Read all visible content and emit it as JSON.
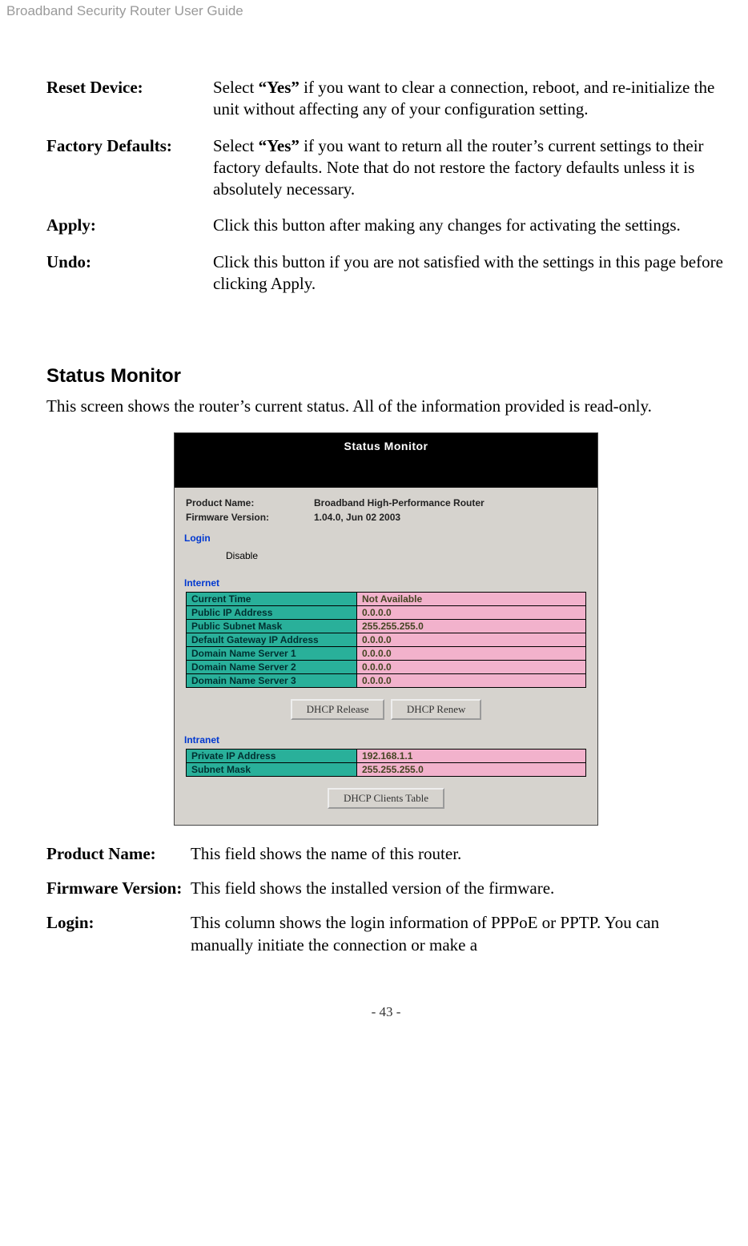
{
  "header": "Broadband Security Router User Guide",
  "defs1": [
    {
      "term": "Reset Device:",
      "pre": "Select ",
      "bold": "“Yes”",
      "post": " if you want to clear a connection, reboot, and re-initialize the unit without affecting any of your configuration setting."
    },
    {
      "term": "Factory Defaults:",
      "pre": "Select ",
      "bold": "“Yes”",
      "post": " if you want to return all the router’s current settings to their factory defaults. Note that do not restore the factory defaults unless it is absolutely necessary."
    },
    {
      "term": "Apply:",
      "pre": "Click this button after making any changes for activating the settings.",
      "bold": "",
      "post": ""
    },
    {
      "term": "Undo:",
      "pre": "Click this button if you are not satisfied with the settings in this page before clicking Apply.",
      "bold": "",
      "post": ""
    }
  ],
  "section": {
    "title": "Status Monitor",
    "intro": "This screen shows the router’s current status. All of the information provided is read-only."
  },
  "screenshot": {
    "title": "Status Monitor",
    "info": {
      "productNameLabel": "Product Name:",
      "productNameValue": "Broadband High-Performance Router",
      "firmwareLabel": "Firmware Version:",
      "firmwareValue": "1.04.0, Jun 02 2003"
    },
    "loginHeader": "Login",
    "loginValue": "Disable",
    "internetHeader": "Internet",
    "internetRows": [
      {
        "k": "Current Time",
        "v": "Not Available"
      },
      {
        "k": "Public IP Address",
        "v": "0.0.0.0"
      },
      {
        "k": "Public Subnet Mask",
        "v": "255.255.255.0"
      },
      {
        "k": "Default Gateway IP Address",
        "v": "0.0.0.0"
      },
      {
        "k": "Domain Name Server 1",
        "v": "0.0.0.0"
      },
      {
        "k": "Domain Name Server 2",
        "v": "0.0.0.0"
      },
      {
        "k": "Domain Name Server 3",
        "v": "0.0.0.0"
      }
    ],
    "dhcpReleaseBtn": "DHCP Release",
    "dhcpRenewBtn": "DHCP Renew",
    "intranetHeader": "Intranet",
    "intranetRows": [
      {
        "k": "Private IP Address",
        "v": "192.168.1.1"
      },
      {
        "k": "Subnet Mask",
        "v": "255.255.255.0"
      }
    ],
    "dhcpClientsBtn": "DHCP Clients Table"
  },
  "defs2": [
    {
      "term": "Product Name:",
      "desc": "This field shows the name of this router."
    },
    {
      "term": "Firmware Version:",
      "desc": "This field shows the installed version of the firmware."
    },
    {
      "term": "Login:",
      "desc": "This column shows the login information of PPPoE or PPTP. You can manually initiate the connection or make a"
    }
  ],
  "footer": "- 43 -"
}
